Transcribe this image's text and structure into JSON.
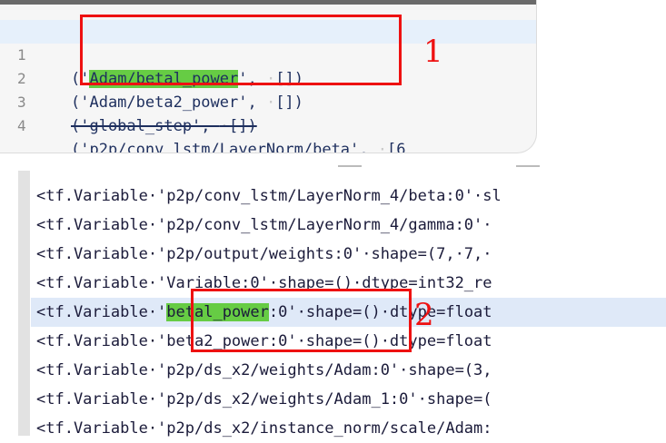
{
  "panel1": {
    "lines": [
      {
        "num": "1",
        "pre": "('",
        "hl": "Adam/betal_power",
        "post": "', ",
        "dot": "·",
        "tail": "[])"
      },
      {
        "num": "2",
        "code": "('Adam/beta2_power', ",
        "dot": "·",
        "tail": "[])"
      },
      {
        "num": "3",
        "code": "('global_step', ",
        "dot": "·",
        "tail": "[])"
      },
      {
        "num": "4",
        "code": "('p2p/conv_lstm/LayerNorm/beta', ",
        "dot": "·",
        "tail": "[6"
      }
    ],
    "annotation_label": "1"
  },
  "panel2": {
    "lines": [
      {
        "code": "<tf.Variable·'p2p/conv_lstm/LayerNorm_4/beta:0'·sl"
      },
      {
        "code": "<tf.Variable·'p2p/conv_lstm/LayerNorm_4/gamma:0'·"
      },
      {
        "code": "<tf.Variable·'p2p/output/weights:0'·shape=(7,·7,·"
      },
      {
        "code": "<tf.Variable·'Variable:0'·shape=()·dtype=int32_re"
      },
      {
        "pre": "<tf.Variable·'",
        "hl": "betal_power",
        "post": ":0'·shape=()·dtype=float"
      },
      {
        "code": "<tf.Variable·'beta2_power:0'·shape=()·dtype=float"
      },
      {
        "code": "<tf.Variable·'p2p/ds_x2/weights/Adam:0'·shape=(3,"
      },
      {
        "code": "<tf.Variable·'p2p/ds_x2/weights/Adam_1:0'·shape=("
      },
      {
        "code": "<tf.Variable·'p2p/ds_x2/instance_norm/scale/Adam:"
      }
    ],
    "annotation_label": "2"
  },
  "colors": {
    "highlight": "#66cc44",
    "annotation": "#ee1111",
    "active_line": "#dfe9f8"
  }
}
